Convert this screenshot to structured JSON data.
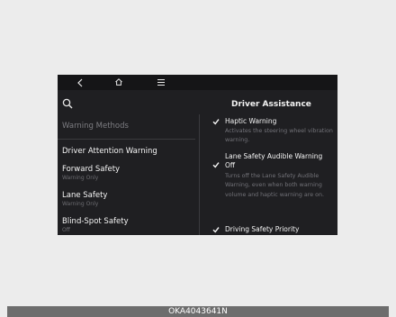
{
  "topbar": {
    "back_icon": "chevron-left-icon",
    "home_icon": "home-icon",
    "menu_icon": "menu-icon"
  },
  "header": {
    "title": "Driver Assistance",
    "search_icon": "search-icon"
  },
  "left_menu": {
    "section_label": "Warning Methods",
    "items": [
      {
        "label": "Driver Attention Warning",
        "sub": ""
      },
      {
        "label": "Forward Safety",
        "sub": "Warning Only"
      },
      {
        "label": "Lane Safety",
        "sub": "Warning Only"
      },
      {
        "label": "Blind-Spot Safety",
        "sub": "Off"
      }
    ]
  },
  "options": [
    {
      "label": "Haptic Warning",
      "checked": true,
      "desc": "Activates the steering wheel vibration warning."
    },
    {
      "label": "Lane Safety Audible Warning Off",
      "checked": true,
      "desc": "Turns off the Lane Safety Audible Warning, even when both warning volume and haptic warning are on."
    },
    {
      "label": "Driving Safety Priority",
      "checked": true,
      "desc": ""
    }
  ],
  "caption": "OKA4043641N",
  "colors": {
    "screen_bg": "#1f1f22",
    "accent": "#f5f5f5",
    "muted": "#727278"
  }
}
